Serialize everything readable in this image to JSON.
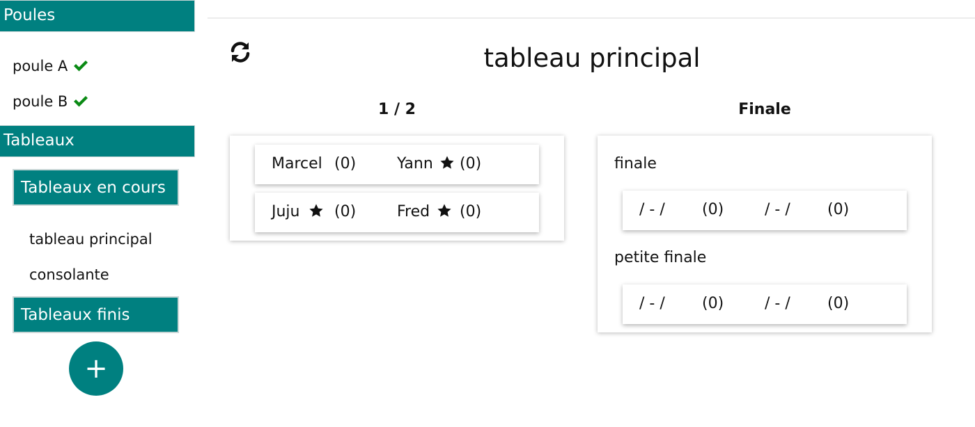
{
  "sidebar": {
    "poules_header": "Poules",
    "pools": [
      {
        "label": "poule A",
        "status_icon": "check-icon"
      },
      {
        "label": "poule B",
        "status_icon": "check-icon"
      }
    ],
    "tableaux_header": "Tableaux",
    "in_progress_header": "Tableaux en cours",
    "in_progress_items": [
      "tableau principal",
      "consolante"
    ],
    "finished_header": "Tableaux finis",
    "add_button": "+"
  },
  "main": {
    "title": "tableau principal",
    "refresh_icon": "refresh-icon",
    "columns": [
      {
        "title": "1 / 2",
        "matches": [
          {
            "p1": "Marcel",
            "p1_star": false,
            "p1_score": "(0)",
            "p2": "Yann",
            "p2_star": true,
            "p2_score": "(0)"
          },
          {
            "p1": "Juju",
            "p1_star": true,
            "p1_score": "(0)",
            "p2": "Fred",
            "p2_star": true,
            "p2_score": "(0)"
          }
        ]
      },
      {
        "title": "Finale",
        "games": [
          {
            "label": "finale",
            "p1": "/ - /",
            "p1_score": "(0)",
            "p2": "/ - /",
            "p2_score": "(0)"
          },
          {
            "label": "petite finale",
            "p1": "/ - /",
            "p1_score": "(0)",
            "p2": "/ - /",
            "p2_score": "(0)"
          }
        ]
      }
    ]
  },
  "colors": {
    "accent": "#008080",
    "check": "#0a8a14"
  }
}
